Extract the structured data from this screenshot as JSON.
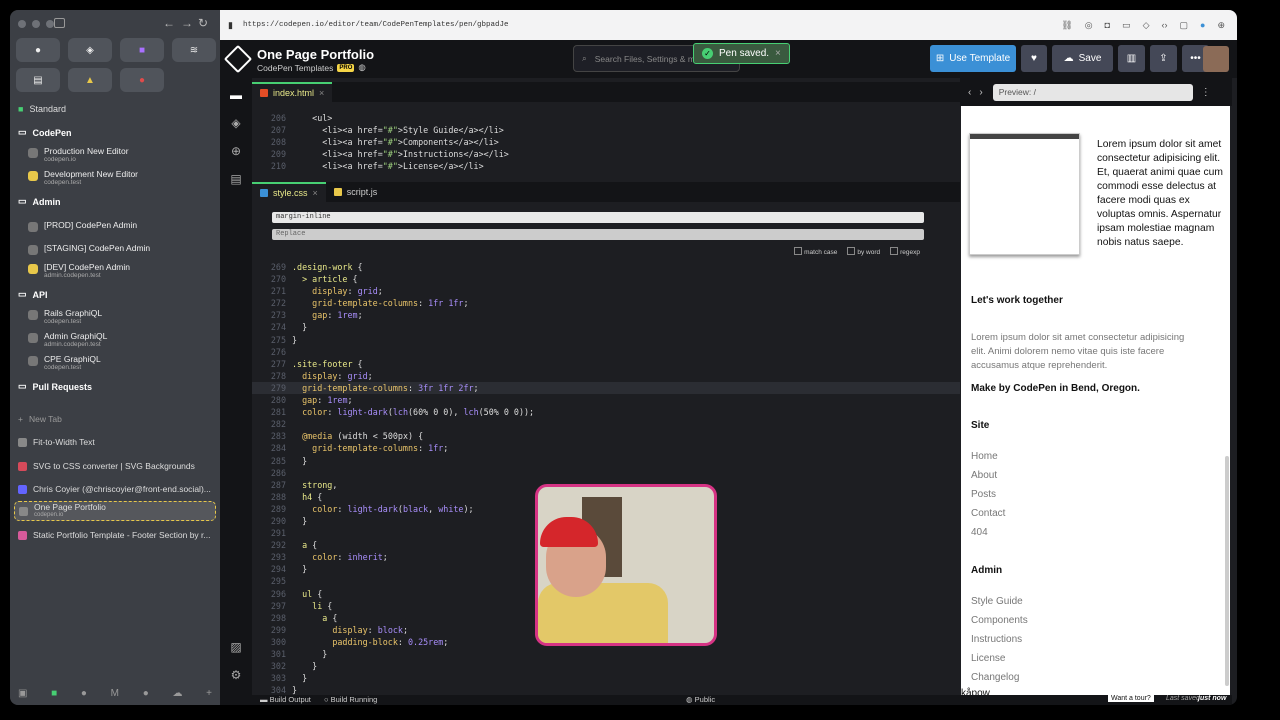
{
  "browser": {
    "url": "https://codepen.io/editor/team/CodePenTemplates/pen/gbpadJe",
    "sidebar": {
      "pinned": [
        "github",
        "codepen",
        "twitch",
        "stack",
        "doc",
        "chart",
        "record"
      ],
      "standard": "Standard",
      "groups": [
        {
          "name": "CodePen",
          "items": [
            {
              "t": "Production New Editor",
              "s": "codepen.io"
            },
            {
              "t": "Development New Editor",
              "s": "codepen.test"
            }
          ]
        },
        {
          "name": "Admin",
          "items": [
            {
              "t": "[PROD] CodePen Admin",
              "s": ""
            },
            {
              "t": "[STAGING] CodePen Admin",
              "s": ""
            },
            {
              "t": "[DEV] CodePen Admin",
              "s": "admin.codepen.test"
            }
          ]
        },
        {
          "name": "API",
          "items": [
            {
              "t": "Rails GraphiQL",
              "s": "codepen.test"
            },
            {
              "t": "Admin GraphiQL",
              "s": "admin.codepen.test"
            },
            {
              "t": "CPE GraphiQL",
              "s": "codepen.test"
            }
          ]
        }
      ],
      "pull_requests": "Pull Requests",
      "new_tab": "New Tab",
      "tabs": [
        "Fit-to-Width Text",
        "SVG to CSS converter | SVG Backgrounds",
        "Chris Coyier (@chriscoyier@front-end.social)...",
        "One Page Portfolio",
        "Static Portfolio Template - Footer Section by r..."
      ],
      "active_tab_sub": "codepen.io"
    }
  },
  "header": {
    "title": "One Page Portfolio",
    "team": "CodePen Templates",
    "pro": "PRO",
    "search_placeholder": "Search Files, Settings & mo",
    "toast": "Pen saved.",
    "use_template": "Use Template",
    "save": "Save"
  },
  "editor": {
    "html_tab": "index.html",
    "css_tab": "style.css",
    "js_tab": "script.js",
    "find_value": "margin-inline",
    "replace_placeholder": "Replace",
    "opt_case": "match case",
    "opt_word": "by word",
    "opt_regex": "regexp",
    "build_output": "Build Output",
    "build_running": "Build Running",
    "public": "Public"
  },
  "preview": {
    "url": "Preview: /",
    "lorem1": "Lorem ipsum dolor sit amet consectetur adipisicing elit. Et, quaerat animi quae cum commodi esse delectus at facere modi quas ex voluptas omnis. Aspernatur ipsam molestiae magnam nobis natus saepe.",
    "work_heading": "Let's work together",
    "lorem2": "Lorem ipsum dolor sit amet consectetur adipisicing elit. Animi dolorem nemo vitae quis iste facere accusamus atque reprehenderit.",
    "made_by": "Make by CodePen in Bend, Oregon.",
    "site_heading": "Site",
    "site_links": [
      "Home",
      "About",
      "Posts",
      "Contact",
      "404"
    ],
    "admin_heading": "Admin",
    "admin_links": [
      "Style Guide",
      "Components",
      "Instructions",
      "License",
      "Changelog"
    ],
    "kapow": "kåpow",
    "tour": "Want a tour?",
    "last_saved": "Last saved",
    "last_saved_when": "just now"
  }
}
